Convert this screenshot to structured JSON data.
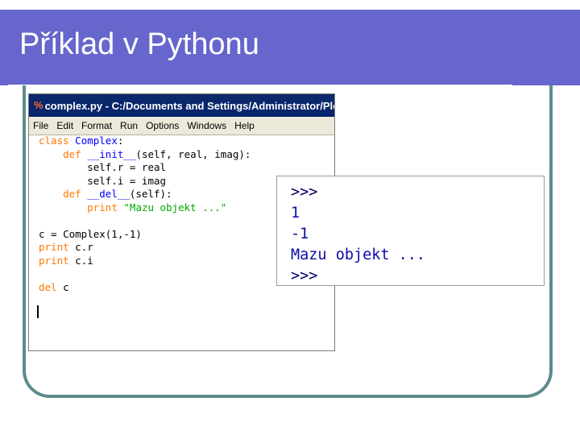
{
  "slide": {
    "title": "Příklad v Pythonu"
  },
  "idle": {
    "window_title": "complex.py - C:/Documents and Settings/Administrator/Plo",
    "menu": [
      "File",
      "Edit",
      "Format",
      "Run",
      "Options",
      "Windows",
      "Help"
    ],
    "code_lines": [
      "class Complex:",
      "    def __init__(self, real, imag):",
      "        self.r = real",
      "        self.i = imag",
      "    def __del__(self):",
      "        print \"Mazu objekt ...\"",
      "",
      "c = Complex(1,-1)",
      "print c.r",
      "print c.i",
      "",
      "del c"
    ]
  },
  "shell": {
    "lines": [
      ">>>",
      "1",
      "-1",
      "Mazu objekt ...",
      ">>>"
    ]
  },
  "colors": {
    "title_bg": "#6666cc",
    "frame": "#5f8a8b",
    "keyword": "#ff7700",
    "string": "#00aa00",
    "definition": "#0000ff"
  }
}
